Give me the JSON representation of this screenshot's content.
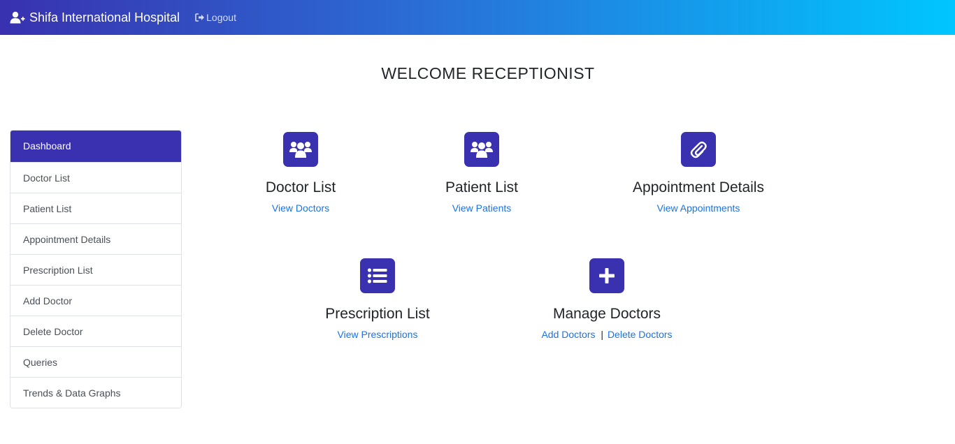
{
  "navbar": {
    "brand": "Shifa International Hospital",
    "brand_icon": "user-plus-icon",
    "logout_label": "Logout",
    "logout_icon": "sign-out-icon",
    "gradient_start": "#3931af",
    "gradient_end": "#00c6ff"
  },
  "welcome": "WELCOME RECEPTIONIST",
  "sidebar": {
    "items": [
      {
        "label": "Dashboard",
        "active": true
      },
      {
        "label": "Doctor List"
      },
      {
        "label": "Patient List"
      },
      {
        "label": "Appointment Details"
      },
      {
        "label": "Prescription List"
      },
      {
        "label": "Add Doctor"
      },
      {
        "label": "Delete Doctor"
      },
      {
        "label": "Queries"
      },
      {
        "label": "Trends & Data Graphs"
      }
    ]
  },
  "cards": {
    "doctor_list": {
      "title": "Doctor List",
      "link": "View Doctors",
      "icon": "users-icon"
    },
    "patient_list": {
      "title": "Patient List",
      "link": "View Patients",
      "icon": "users-icon"
    },
    "appointment_details": {
      "title": "Appointment Details",
      "link": "View Appointments",
      "icon": "paperclip-icon"
    },
    "prescription_list": {
      "title": "Prescription List",
      "link": "View Prescriptions",
      "icon": "list-icon"
    },
    "manage_doctors": {
      "title": "Manage Doctors",
      "link_add": "Add Doctors",
      "separator": "|",
      "link_delete": "Delete Doctors",
      "icon": "plus-square-icon"
    }
  },
  "colors": {
    "accent": "#3931af",
    "link": "#1a73e8"
  }
}
